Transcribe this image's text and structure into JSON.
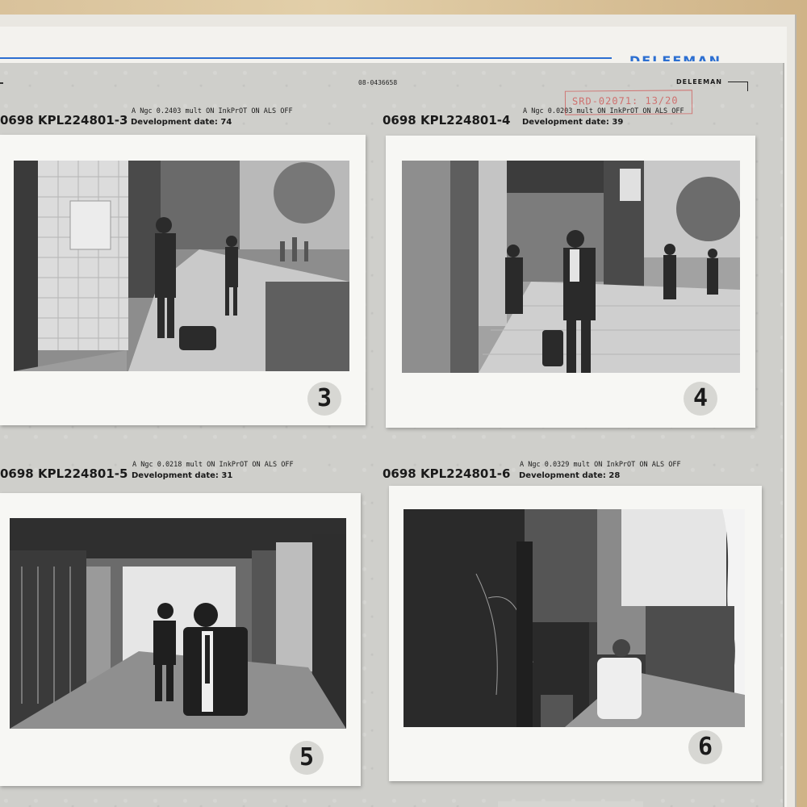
{
  "header": {
    "brand_blue": "DELEEMAN",
    "serial": "08-0436658",
    "brand": "DELEEMAN",
    "stamp": "SRD-02071: 13/20"
  },
  "frames": [
    {
      "code": "0698 KPL224801-3",
      "params": "A Ngc 0.2403 mult ON InkPrOT ON ALS OFF",
      "development": "Development date: 74",
      "number": "3",
      "photo": "man-in-suit-walking-past-tiled-arcade-icon"
    },
    {
      "code": "0698 KPL224801-4",
      "params": "A Ngc 0.0203 mult ON InkPrOT ON ALS OFF",
      "development": "Development date: 39",
      "number": "4",
      "photo": "man-in-suit-under-colonnade-icon"
    },
    {
      "code": "0698 KPL224801-5",
      "params": "A Ngc 0.0218 mult ON InkPrOT ON ALS OFF",
      "development": "Development date: 31",
      "number": "5",
      "photo": "man-walking-through-covered-walkway-icon"
    },
    {
      "code": "0698 KPL224801-6",
      "params": "A Ngc 0.0329 mult ON InkPrOT ON ALS OFF",
      "development": "Development date: 28",
      "number": "6",
      "photo": "faded-street-scene-with-man-in-white-shirt-icon"
    }
  ]
}
